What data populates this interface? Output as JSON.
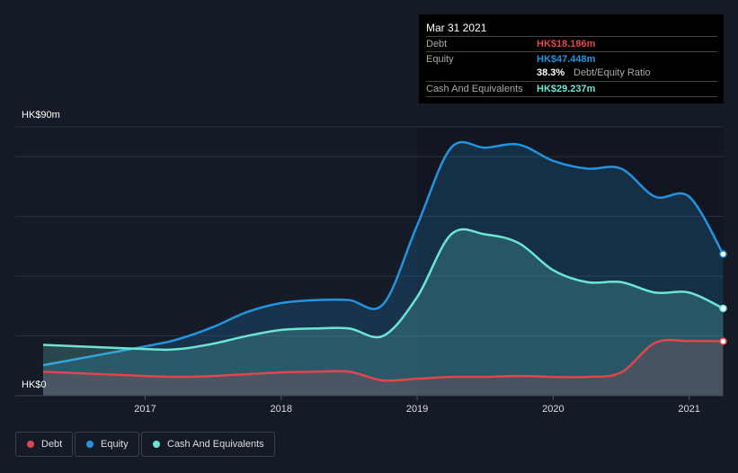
{
  "tooltip": {
    "date": "Mar 31 2021",
    "debt_label": "Debt",
    "debt_value": "HK$18.186m",
    "equity_label": "Equity",
    "equity_value": "HK$47.448m",
    "ratio_value": "38.3%",
    "ratio_label": "Debt/Equity Ratio",
    "cash_label": "Cash And Equivalents",
    "cash_value": "HK$29.237m"
  },
  "legend": [
    {
      "label": "Debt",
      "color": "#e0474c"
    },
    {
      "label": "Equity",
      "color": "#2394df"
    },
    {
      "label": "Cash And Equivalents",
      "color": "#6ce5d4"
    }
  ],
  "chart_data": {
    "type": "area",
    "ylabel_top": "HK$90m",
    "ylabel_bottom": "HK$0",
    "ylim": [
      0,
      90
    ],
    "xlim": [
      2016.25,
      2021.25
    ],
    "xticks": [
      "2017",
      "2018",
      "2019",
      "2020",
      "2021"
    ],
    "x": [
      2016.25,
      2017,
      2017.25,
      2017.5,
      2017.75,
      2018,
      2018.25,
      2018.5,
      2018.75,
      2019,
      2019.25,
      2019.5,
      2019.75,
      2020,
      2020.25,
      2020.5,
      2020.75,
      2021,
      2021.25
    ],
    "series": [
      {
        "name": "Equity",
        "color": "#2394df",
        "values": [
          10.2,
          16.5,
          19,
          23,
          28,
          31,
          32,
          32,
          30.6,
          57,
          83,
          83,
          84,
          78.6,
          76,
          76,
          66.6,
          66.6,
          47.4
        ]
      },
      {
        "name": "Cash And Equivalents",
        "color": "#6ce5d4",
        "values": [
          17,
          15.6,
          15.6,
          17.4,
          20,
          22,
          22.5,
          22.5,
          20,
          33,
          54,
          54,
          51,
          42,
          38,
          38,
          34.5,
          34.5,
          29.2
        ]
      },
      {
        "name": "Debt",
        "color": "#e0474c",
        "values": [
          8,
          6.6,
          6.3,
          6.6,
          7.2,
          7.8,
          8,
          8,
          5.1,
          5.7,
          6.3,
          6.3,
          6.6,
          6.3,
          6.3,
          7.8,
          17.7,
          18.3,
          18.2
        ]
      }
    ]
  }
}
